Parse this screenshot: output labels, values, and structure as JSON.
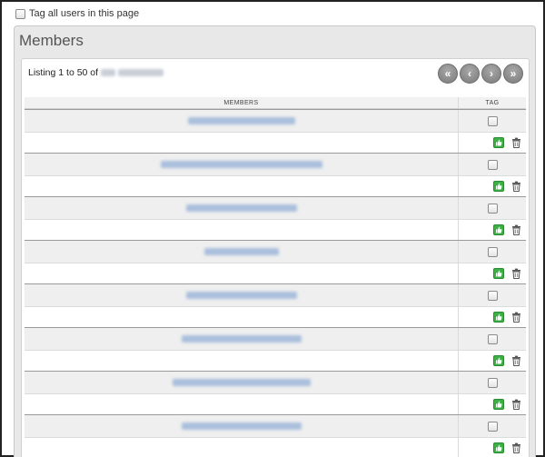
{
  "tag_all_label": "Tag all users in this page",
  "panel_title": "Members",
  "listing": {
    "prefix": "Listing 1 to 50 of"
  },
  "pager": {
    "first": "«",
    "prev": "‹",
    "next": "›",
    "last": "»"
  },
  "table": {
    "col_members": "MEMBERS",
    "col_tag": "TAG"
  },
  "icons": {
    "approve": "thumbs-up-icon",
    "delete": "trash-icon"
  },
  "colors": {
    "approve_green": "#3cb043",
    "pager_grey": "#8c8c8c"
  }
}
